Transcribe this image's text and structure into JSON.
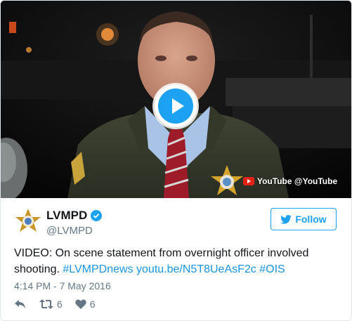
{
  "video": {
    "play_label": "Play video",
    "source_label": "YouTube @YouTube",
    "accent_color": "#1da1f2"
  },
  "author": {
    "display_name": "LVMPD",
    "handle": "@LVMPD",
    "verified_icon": "verified-badge-icon",
    "avatar_icon": "sheriff-star-icon"
  },
  "follow_button": {
    "label": "Follow",
    "icon": "twitter-bird-icon"
  },
  "tweet": {
    "text_plain": "VIDEO: On scene statement from overnight officer involved shooting.",
    "link_hashtag_1": "#LVMPDnews",
    "link_url": "youtu.be/N5T8UeAsF2c",
    "link_hashtag_2": "#OIS",
    "timestamp": "4:14 PM - 7 May 2016"
  },
  "actions": {
    "reply_icon": "reply-icon",
    "retweet_icon": "retweet-icon",
    "retweet_count": "6",
    "like_icon": "heart-icon",
    "like_count": "6"
  },
  "colors": {
    "link": "#1b95e0",
    "secondary_text": "#657786",
    "primary_text": "#14171a",
    "youtube_red": "#e62117"
  }
}
